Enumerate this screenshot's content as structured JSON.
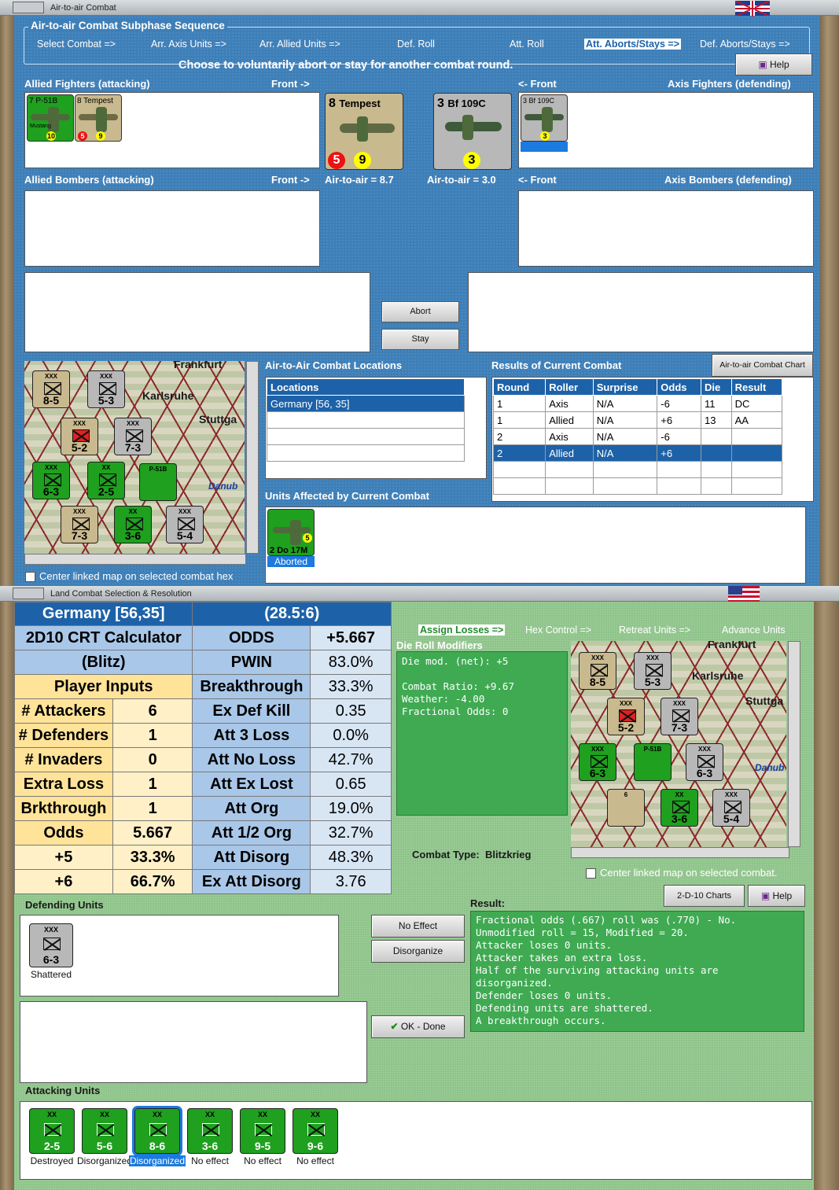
{
  "top_window": {
    "title": "Air-to-air Combat",
    "group_title": "Air-to-air Combat Subphase Sequence",
    "sequence": [
      "Select Combat =>",
      "Arr. Axis Units =>",
      "Arr. Allied Units =>",
      "Def. Roll",
      "Att. Roll",
      "Att. Aborts/Stays =>",
      "Def. Aborts/Stays =>"
    ],
    "instruction": "Choose to voluntarily abort or stay for another combat round.",
    "help": "Help",
    "allied_fighters": "Allied Fighters (attacking)",
    "front_right": "Front ->",
    "front_left": "<- Front",
    "axis_fighters": "Axis Fighters (defending)",
    "allied_bombers": "Allied Bombers (attacking)",
    "axis_bombers": "Axis Bombers (defending)",
    "a2a_left": "Air-to-air = 8.7",
    "a2a_right": "Air-to-air = 3.0",
    "abort": "Abort",
    "stay": "Stay",
    "locations_title": "Air-to-Air Combat Locations",
    "locations_header": "Locations",
    "location_selected": "Germany [56, 35]",
    "results_title": "Results of Current Combat",
    "chart_button": "Air-to-air Combat Chart",
    "results_headers": [
      "Round",
      "Roller",
      "Surprise",
      "Odds",
      "Die",
      "Result"
    ],
    "results_rows": [
      [
        "1",
        "Axis",
        "N/A",
        "-6",
        "11",
        "DC"
      ],
      [
        "1",
        "Allied",
        "N/A",
        "+6",
        "13",
        "AA"
      ],
      [
        "2",
        "Axis",
        "N/A",
        "-6",
        "",
        ""
      ],
      [
        "2",
        "Allied",
        "N/A",
        "+6",
        "",
        ""
      ]
    ],
    "affected_title": "Units Affected by Current Combat",
    "affected_unit": "Do 17M",
    "affected_status": "Aborted",
    "center_map": "Center linked map on selected combat hex",
    "counters": {
      "p51": "P-51B",
      "mustang": "Mustang",
      "tempest": "Tempest",
      "bf109": "Bf 109C",
      "tempest_big": "Tempest",
      "bf109_big": "Bf 109C"
    },
    "map_labels": {
      "frankfurt": "Frankfurt",
      "karlsruhe": "Karlsruhe",
      "stuttgart": "Stuttga",
      "danube": "Danub"
    }
  },
  "bottom_window": {
    "title": "Land Combat Selection & Resolution",
    "tabs": [
      "Assign Losses =>",
      "Hex Control =>",
      "Retreat Units =>",
      "Advance Units"
    ],
    "die_title": "Die Roll Modifiers",
    "die_text": "Die mod. (net): +5\n\nCombat Ratio: +9.67\nWeather: -4.00\nFractional Odds: 0",
    "combat_type_label": "Combat Type:",
    "combat_type": "Blitzkrieg",
    "center_map": "Center linked map on selected combat.",
    "charts_button": "2-D-10 Charts",
    "help": "Help",
    "defending_title": "Defending Units",
    "defending_unit_val": "6-3",
    "defending_status": "Shattered",
    "no_effect": "No Effect",
    "disorganize": "Disorganize",
    "ok_done": "OK - Done",
    "result_title": "Result:",
    "result_lines": [
      "Fractional odds (.667) roll was (.770)  - No.",
      "Unmodified roll = 15, Modified = 20.",
      "Attacker loses 0 units.",
      "Attacker takes an extra loss.",
      "Half of the surviving attacking units are disorganized.",
      "Defender loses 0 units.",
      "Defending units are shattered.",
      "A breakthrough occurs."
    ],
    "attacking_title": "Attacking Units",
    "attackers": [
      {
        "val": "2-5",
        "status": "Destroyed"
      },
      {
        "val": "5-6",
        "status": "Disorganized"
      },
      {
        "val": "8-6",
        "status": "Disorganized"
      },
      {
        "val": "3-6",
        "status": "No effect"
      },
      {
        "val": "9-5",
        "status": "No effect"
      },
      {
        "val": "9-6",
        "status": "No effect"
      }
    ],
    "map_labels": {
      "frankfurt": "Frankfurt",
      "karlsruhe": "Karlsruhe",
      "stuttgart": "Stuttga",
      "danube": "Danub"
    }
  },
  "crt": {
    "header_left": "Germany [56,35]",
    "header_right": "(28.5:6)",
    "calc1": "2D10 CRT Calculator",
    "calc2": "(Blitz)",
    "player_inputs": "Player Inputs",
    "rows": [
      [
        "ODDS",
        "+5.667"
      ],
      [
        "PWIN",
        "83.0%"
      ],
      [
        "Breakthrough",
        "33.3%"
      ],
      [
        "Ex Def Kill",
        "0.35"
      ],
      [
        "Att 3 Loss",
        "0.0%"
      ],
      [
        "Att No Loss",
        "42.7%"
      ],
      [
        "Att Ex Lost",
        "0.65"
      ],
      [
        "Att Org",
        "19.0%"
      ],
      [
        "Att 1/2 Org",
        "32.7%"
      ],
      [
        "Att Disorg",
        "48.3%"
      ],
      [
        "Ex Att Disorg",
        "3.76"
      ]
    ],
    "inputs": [
      [
        "# Attackers",
        "6"
      ],
      [
        "# Defenders",
        "1"
      ],
      [
        "# Invaders",
        "0"
      ],
      [
        "Extra Loss",
        "1"
      ],
      [
        "Brkthrough",
        "1"
      ],
      [
        "Odds",
        "5.667"
      ],
      [
        "+5",
        "33.3%"
      ],
      [
        "+6",
        "66.7%"
      ]
    ]
  }
}
